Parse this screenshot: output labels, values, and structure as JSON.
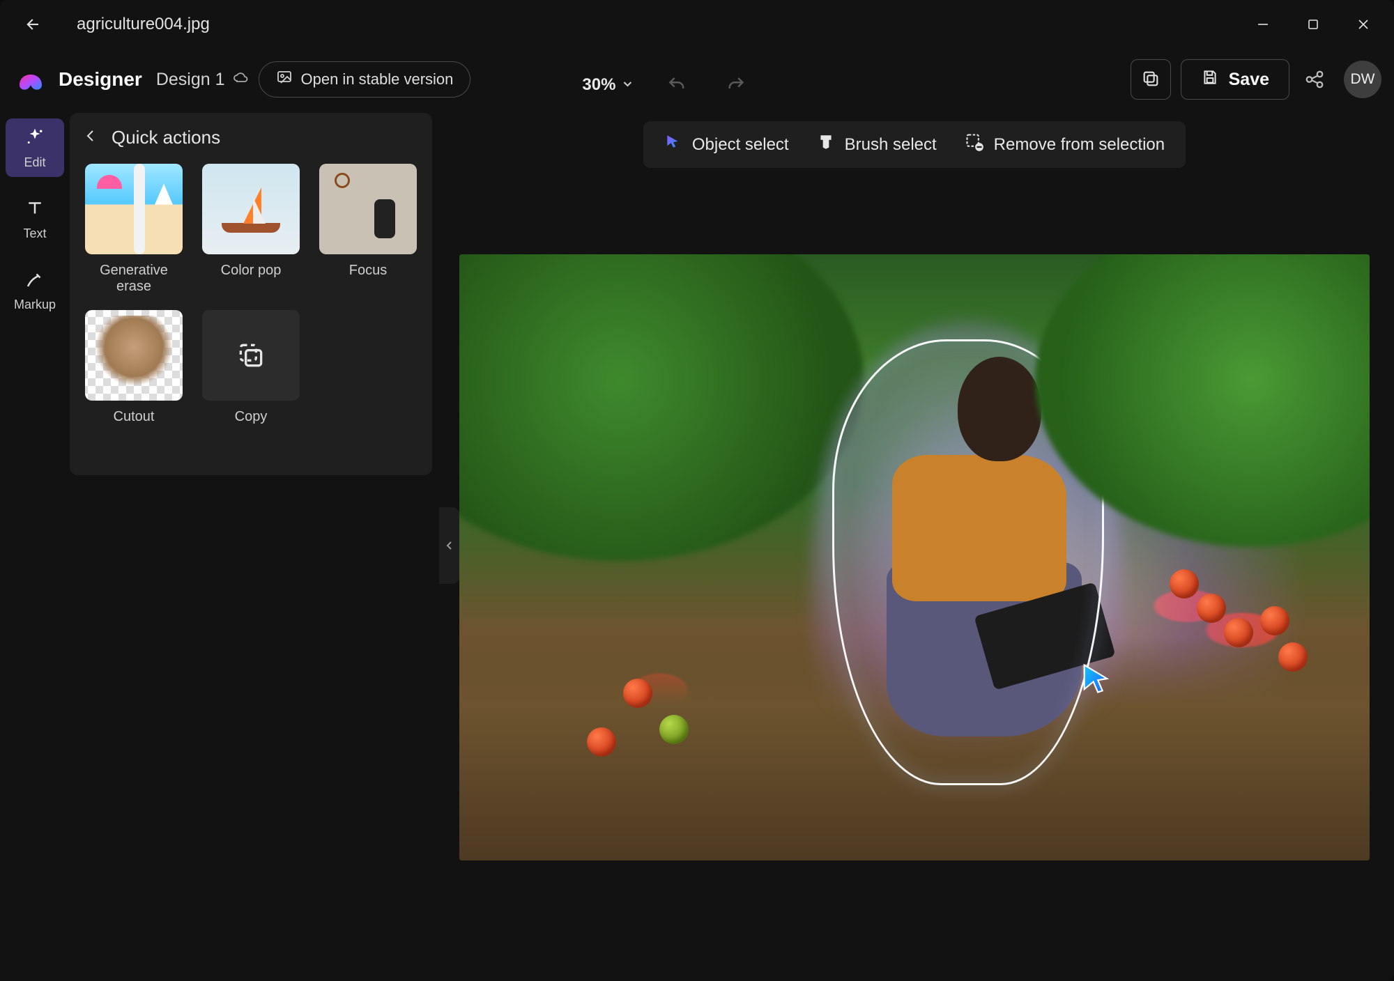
{
  "titlebar": {
    "filename": "agriculture004.jpg"
  },
  "toolbar": {
    "app_name": "Designer",
    "design_label": "Design 1",
    "open_stable_label": "Open in stable version",
    "zoom_label": "30%",
    "save_label": "Save",
    "avatar_initials": "DW"
  },
  "rail": {
    "items": [
      {
        "id": "edit",
        "label": "Edit"
      },
      {
        "id": "text",
        "label": "Text"
      },
      {
        "id": "markup",
        "label": "Markup"
      }
    ]
  },
  "panel": {
    "title": "Quick actions",
    "actions": [
      {
        "id": "generative_erase",
        "label": "Generative erase"
      },
      {
        "id": "color_pop",
        "label": "Color pop"
      },
      {
        "id": "focus",
        "label": "Focus"
      },
      {
        "id": "cutout",
        "label": "Cutout"
      },
      {
        "id": "copy",
        "label": "Copy"
      }
    ]
  },
  "selection_bar": {
    "object_select": "Object select",
    "brush_select": "Brush select",
    "remove_from_selection": "Remove from selection"
  }
}
